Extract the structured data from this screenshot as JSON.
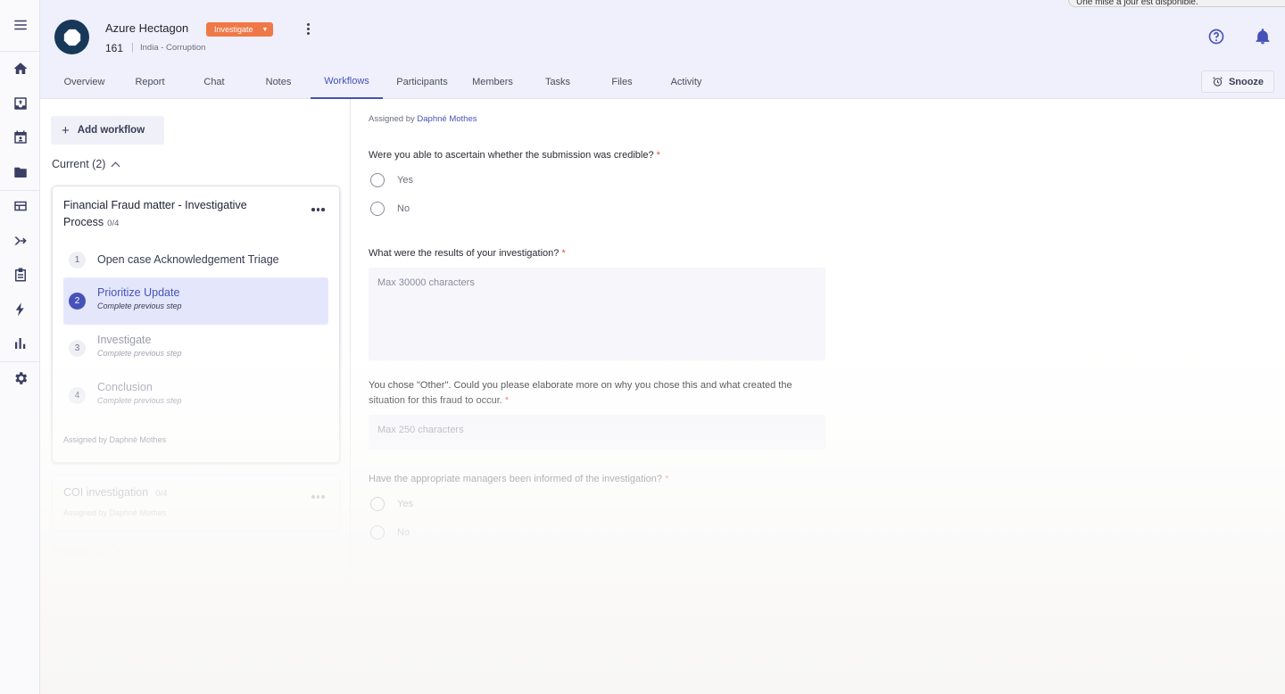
{
  "rail": {
    "items": [
      {
        "icon": "menu-icon"
      },
      {
        "icon": "home-icon"
      },
      {
        "icon": "inbox-icon"
      },
      {
        "icon": "calendar-icon"
      },
      {
        "icon": "folder-icon"
      },
      {
        "icon": "table-icon"
      },
      {
        "icon": "merge-arrow-icon"
      },
      {
        "icon": "clipboard-icon"
      },
      {
        "icon": "lightning-icon"
      },
      {
        "icon": "bar-chart-icon"
      },
      {
        "icon": "gear-icon"
      }
    ]
  },
  "header": {
    "case_name": "Azure Hectagon",
    "status": "Investigate",
    "case_number": "161",
    "separator": "|",
    "case_meta": "India - Corruption",
    "toast": "Une mise à jour est disponible."
  },
  "tabs": [
    {
      "label": "Overview",
      "active": false
    },
    {
      "label": "Report",
      "active": false
    },
    {
      "label": "Chat",
      "active": false
    },
    {
      "label": "Notes",
      "active": false
    },
    {
      "label": "Workflows",
      "active": true
    },
    {
      "label": "Participants",
      "active": false
    },
    {
      "label": "Members",
      "active": false
    },
    {
      "label": "Tasks",
      "active": false
    },
    {
      "label": "Files",
      "active": false
    },
    {
      "label": "Activity",
      "active": false
    }
  ],
  "snooze_label": "Snooze",
  "workflows": {
    "add_label": "Add workflow",
    "current_heading": "Current (2)",
    "previous_heading": "Previous (2)",
    "cards": [
      {
        "title": "Financial Fraud matter - Investigative Process",
        "progress": "0/4",
        "assigned": "Assigned by Daphné Mothes",
        "steps": [
          {
            "num": "1",
            "label": "Open case Acknowledgement Triage",
            "sub": ""
          },
          {
            "num": "2",
            "label": "Prioritize Update",
            "sub": "Complete previous step"
          },
          {
            "num": "3",
            "label": "Investigate",
            "sub": "Complete previous step"
          },
          {
            "num": "4",
            "label": "Conclusion",
            "sub": "Complete previous step"
          }
        ]
      },
      {
        "title": "COI investigation",
        "progress": "0/4",
        "assigned": "Assigned by Daphné Mothes"
      }
    ]
  },
  "form": {
    "assigned_prefix": "Assigned by",
    "assigned_name": "Daphné Mothes",
    "q1": "Were you able to ascertain whether the submission was credible?",
    "q1_options": [
      "Yes",
      "No"
    ],
    "q2": "What were the results of your investigation?",
    "q2_placeholder": "Max 30000 characters",
    "q3_line1": "You chose \"Other\". Could you please elaborate more on why you chose this and what created the",
    "q3_line2": "situation for this fraud to occur.",
    "q3_placeholder": "Max 250 characters",
    "q4": "Have the appropriate managers been informed of the investigation?",
    "q4_options": [
      "Yes",
      "No"
    ],
    "required_mark": "*"
  },
  "colors": {
    "accent": "#4652b8",
    "status": "#f07846",
    "logo": "#183859",
    "required": "#e0533c"
  }
}
